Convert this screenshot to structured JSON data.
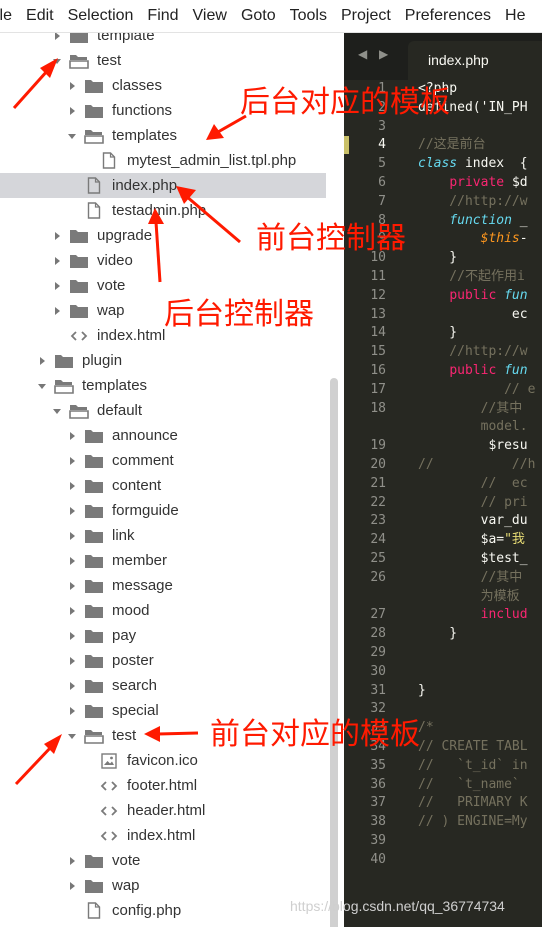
{
  "menu": [
    "ile",
    "Edit",
    "Selection",
    "Find",
    "View",
    "Goto",
    "Tools",
    "Project",
    "Preferences",
    "He"
  ],
  "sidebar": {
    "items": [
      {
        "label": "template",
        "depth": 1,
        "type": "folder",
        "state": "collapsed",
        "selected": false
      },
      {
        "label": "test",
        "depth": 1,
        "type": "folder",
        "state": "expanded",
        "selected": false
      },
      {
        "label": "classes",
        "depth": 2,
        "type": "folder",
        "state": "collapsed",
        "selected": false
      },
      {
        "label": "functions",
        "depth": 2,
        "type": "folder",
        "state": "collapsed",
        "selected": false
      },
      {
        "label": "templates",
        "depth": 2,
        "type": "folder",
        "state": "expanded",
        "selected": false
      },
      {
        "label": "mytest_admin_list.tpl.php",
        "depth": 3,
        "type": "file",
        "state": "none",
        "selected": false
      },
      {
        "label": "index.php",
        "depth": 2,
        "type": "file",
        "state": "none",
        "selected": true
      },
      {
        "label": "testadmin.php",
        "depth": 2,
        "type": "file",
        "state": "none",
        "selected": false
      },
      {
        "label": "upgrade",
        "depth": 1,
        "type": "folder",
        "state": "collapsed",
        "selected": false
      },
      {
        "label": "video",
        "depth": 1,
        "type": "folder",
        "state": "collapsed",
        "selected": false
      },
      {
        "label": "vote",
        "depth": 1,
        "type": "folder",
        "state": "collapsed",
        "selected": false
      },
      {
        "label": "wap",
        "depth": 1,
        "type": "folder",
        "state": "collapsed",
        "selected": false
      },
      {
        "label": "index.html",
        "depth": 1,
        "type": "code",
        "state": "none",
        "selected": false
      },
      {
        "label": "plugin",
        "depth": 0,
        "type": "folder",
        "state": "collapsed",
        "selected": false
      },
      {
        "label": "templates",
        "depth": 0,
        "type": "folder",
        "state": "expanded",
        "selected": false
      },
      {
        "label": "default",
        "depth": 1,
        "type": "folder",
        "state": "expanded",
        "selected": false
      },
      {
        "label": "announce",
        "depth": 2,
        "type": "folder",
        "state": "collapsed",
        "selected": false
      },
      {
        "label": "comment",
        "depth": 2,
        "type": "folder",
        "state": "collapsed",
        "selected": false
      },
      {
        "label": "content",
        "depth": 2,
        "type": "folder",
        "state": "collapsed",
        "selected": false
      },
      {
        "label": "formguide",
        "depth": 2,
        "type": "folder",
        "state": "collapsed",
        "selected": false
      },
      {
        "label": "link",
        "depth": 2,
        "type": "folder",
        "state": "collapsed",
        "selected": false
      },
      {
        "label": "member",
        "depth": 2,
        "type": "folder",
        "state": "collapsed",
        "selected": false
      },
      {
        "label": "message",
        "depth": 2,
        "type": "folder",
        "state": "collapsed",
        "selected": false
      },
      {
        "label": "mood",
        "depth": 2,
        "type": "folder",
        "state": "collapsed",
        "selected": false
      },
      {
        "label": "pay",
        "depth": 2,
        "type": "folder",
        "state": "collapsed",
        "selected": false
      },
      {
        "label": "poster",
        "depth": 2,
        "type": "folder",
        "state": "collapsed",
        "selected": false
      },
      {
        "label": "search",
        "depth": 2,
        "type": "folder",
        "state": "collapsed",
        "selected": false
      },
      {
        "label": "special",
        "depth": 2,
        "type": "folder",
        "state": "collapsed",
        "selected": false
      },
      {
        "label": "test",
        "depth": 2,
        "type": "folder",
        "state": "expanded",
        "selected": false
      },
      {
        "label": "favicon.ico",
        "depth": 3,
        "type": "image",
        "state": "none",
        "selected": false
      },
      {
        "label": "footer.html",
        "depth": 3,
        "type": "code",
        "state": "none",
        "selected": false
      },
      {
        "label": "header.html",
        "depth": 3,
        "type": "code",
        "state": "none",
        "selected": false
      },
      {
        "label": "index.html",
        "depth": 3,
        "type": "code",
        "state": "none",
        "selected": false
      },
      {
        "label": "vote",
        "depth": 2,
        "type": "folder",
        "state": "collapsed",
        "selected": false
      },
      {
        "label": "wap",
        "depth": 2,
        "type": "folder",
        "state": "collapsed",
        "selected": false
      },
      {
        "label": "config.php",
        "depth": 2,
        "type": "file",
        "state": "none",
        "selected": false
      }
    ]
  },
  "editor": {
    "nav_arrows": "◀ ▶",
    "tab_title": "index.php",
    "current_line": 4,
    "lines": [
      {
        "n": "1",
        "tokens": [
          [
            "tx",
            "<?php"
          ]
        ]
      },
      {
        "n": "2",
        "tokens": [
          [
            "tx",
            "defined('IN_PH"
          ]
        ]
      },
      {
        "n": "3",
        "tokens": []
      },
      {
        "n": "4",
        "tokens": [
          [
            "cm",
            "//这是前台"
          ]
        ]
      },
      {
        "n": "5",
        "tokens": [
          [
            "st",
            "class "
          ],
          [
            "tx",
            "index  {"
          ]
        ]
      },
      {
        "n": "6",
        "tokens": [
          [
            "tx",
            "    "
          ],
          [
            "kw",
            "private "
          ],
          [
            "tx",
            "$d"
          ]
        ]
      },
      {
        "n": "7",
        "tokens": [
          [
            "cm",
            "    //http://w"
          ]
        ]
      },
      {
        "n": "8",
        "tokens": [
          [
            "tx",
            "    "
          ],
          [
            "st",
            "function "
          ],
          [
            "tx",
            "_"
          ]
        ]
      },
      {
        "n": "9",
        "tokens": [
          [
            "tx",
            "        "
          ],
          [
            "var",
            "$this"
          ],
          [
            "tx",
            "-"
          ]
        ]
      },
      {
        "n": "10",
        "tokens": [
          [
            "tx",
            "    }"
          ]
        ]
      },
      {
        "n": "11",
        "tokens": [
          [
            "cm",
            "    //不起作用i"
          ]
        ]
      },
      {
        "n": "12",
        "tokens": [
          [
            "tx",
            "    "
          ],
          [
            "kw",
            "public "
          ],
          [
            "st",
            "fun"
          ]
        ]
      },
      {
        "n": "13",
        "tokens": [
          [
            "tx",
            "            ec"
          ]
        ]
      },
      {
        "n": "14",
        "tokens": [
          [
            "tx",
            "    }"
          ]
        ]
      },
      {
        "n": "15",
        "tokens": [
          [
            "cm",
            "    //http://w"
          ]
        ]
      },
      {
        "n": "16",
        "tokens": [
          [
            "tx",
            "    "
          ],
          [
            "kw",
            "public "
          ],
          [
            "st",
            "fun"
          ]
        ]
      },
      {
        "n": "17",
        "tokens": [
          [
            "cm",
            "           // e"
          ]
        ]
      },
      {
        "n": "18",
        "tokens": [
          [
            "cm",
            "        //其中"
          ]
        ]
      },
      {
        "n": "",
        "tokens": [
          [
            "cm",
            "        model."
          ]
        ]
      },
      {
        "n": "19",
        "tokens": [
          [
            "tx",
            "         $resu"
          ]
        ]
      },
      {
        "n": "20",
        "tokens": [
          [
            "cm",
            "//          //h"
          ]
        ]
      },
      {
        "n": "21",
        "tokens": [
          [
            "cm",
            "        //  ec"
          ]
        ]
      },
      {
        "n": "22",
        "tokens": [
          [
            "cm",
            "        // pri"
          ]
        ]
      },
      {
        "n": "23",
        "tokens": [
          [
            "tx",
            "        var_du"
          ]
        ]
      },
      {
        "n": "24",
        "tokens": [
          [
            "tx",
            "        $a="
          ],
          [
            "str",
            "\"我"
          ]
        ]
      },
      {
        "n": "25",
        "tokens": [
          [
            "tx",
            "        $test_"
          ]
        ]
      },
      {
        "n": "26",
        "tokens": [
          [
            "cm",
            "        //其中 "
          ]
        ]
      },
      {
        "n": "",
        "tokens": [
          [
            "cm",
            "        为模板"
          ]
        ]
      },
      {
        "n": "27",
        "tokens": [
          [
            "tx",
            "        "
          ],
          [
            "kw",
            "includ"
          ]
        ]
      },
      {
        "n": "28",
        "tokens": [
          [
            "tx",
            "    }"
          ]
        ]
      },
      {
        "n": "29",
        "tokens": []
      },
      {
        "n": "30",
        "tokens": []
      },
      {
        "n": "31",
        "tokens": [
          [
            "tx",
            "}"
          ]
        ]
      },
      {
        "n": "32",
        "tokens": []
      },
      {
        "n": "33",
        "tokens": [
          [
            "cm",
            "/*"
          ]
        ]
      },
      {
        "n": "34",
        "tokens": [
          [
            "cm",
            "// CREATE TABL"
          ]
        ]
      },
      {
        "n": "35",
        "tokens": [
          [
            "cm",
            "//   `t_id` in"
          ]
        ]
      },
      {
        "n": "36",
        "tokens": [
          [
            "cm",
            "//   `t_name`"
          ]
        ]
      },
      {
        "n": "37",
        "tokens": [
          [
            "cm",
            "//   PRIMARY K"
          ]
        ]
      },
      {
        "n": "38",
        "tokens": [
          [
            "cm",
            "// ) ENGINE=My"
          ]
        ]
      },
      {
        "n": "39",
        "tokens": []
      },
      {
        "n": "40",
        "tokens": []
      }
    ]
  },
  "annotations": [
    {
      "text": "后台对应的模板"
    },
    {
      "text": "前台控制器"
    },
    {
      "text": "后台控制器"
    },
    {
      "text": "前台对应的模板"
    }
  ],
  "colors": {
    "annotation": "#ff1a00",
    "editor_bg": "#272822",
    "keyword": "#f92672",
    "storage": "#66d9ef",
    "string": "#e6db74",
    "comment": "#75715e",
    "selection_row": "#d5d6da"
  },
  "watermark": "https://blog.csdn.net/qq_36774734"
}
